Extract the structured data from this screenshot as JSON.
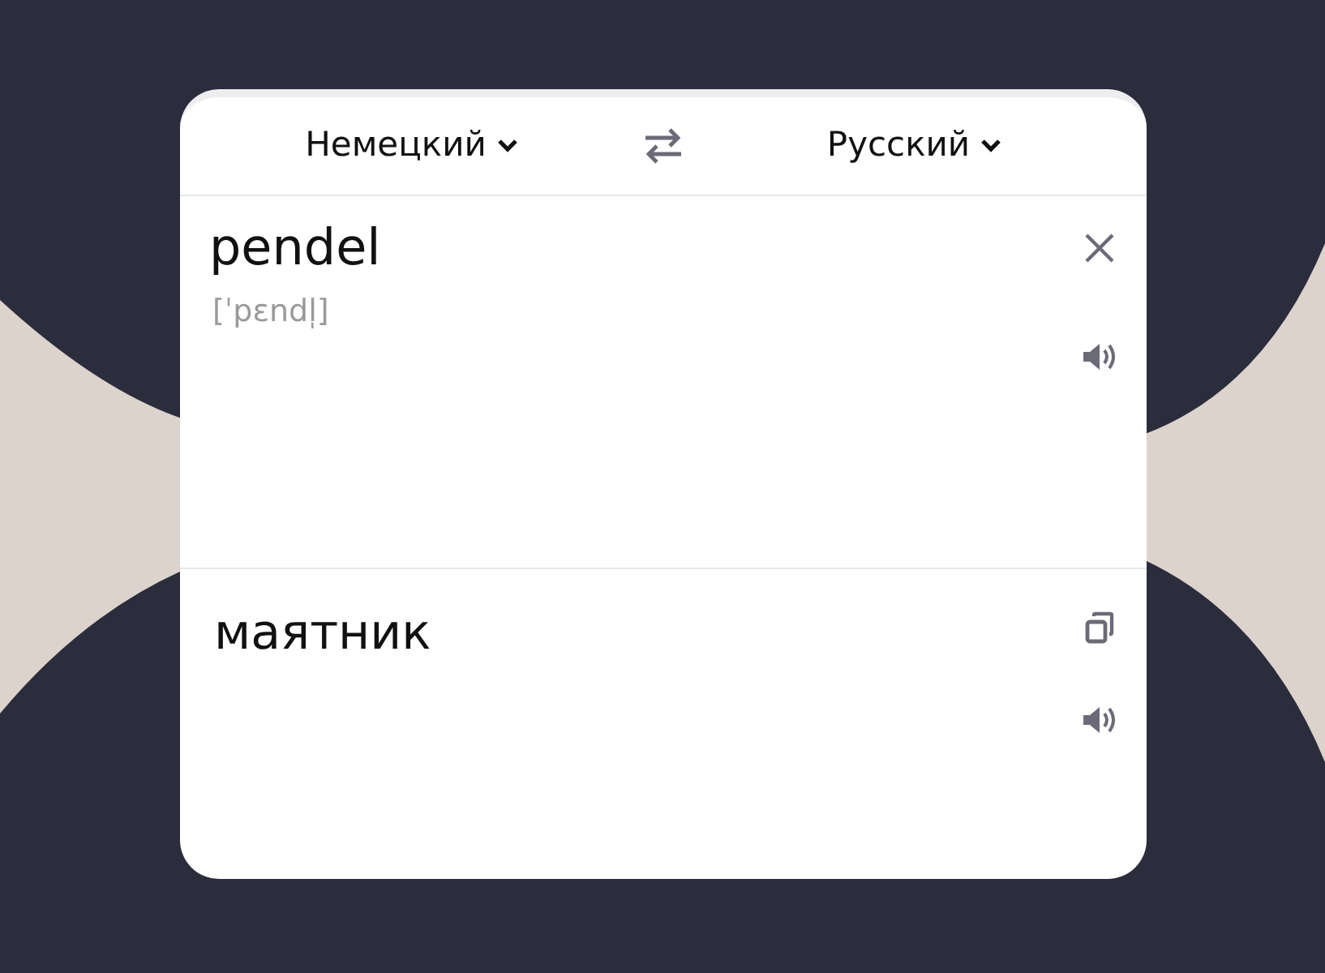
{
  "language_bar": {
    "source_language": "Немецкий",
    "target_language": "Русский"
  },
  "source": {
    "text": "pendel",
    "transcription": "[ˈpɛndl̩]"
  },
  "translation": {
    "text": "маятник"
  }
}
